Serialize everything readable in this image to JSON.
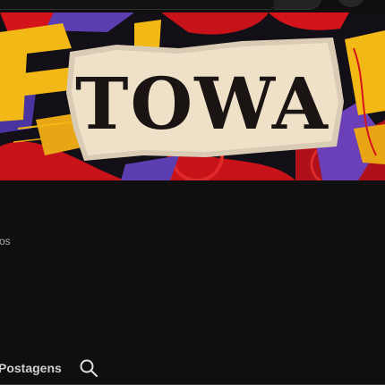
{
  "banner": {
    "title": "TOWA"
  },
  "channel": {
    "subscriber_fragment": "os"
  },
  "tabs": {
    "posts_label": "Postagens",
    "search_icon": "search-icon"
  },
  "colors": {
    "background": "#0f0f0f",
    "banner_yellow": "#f2b816",
    "banner_red": "#d4141b",
    "banner_purple": "#5b3fb0",
    "paper": "#efe0c8"
  }
}
